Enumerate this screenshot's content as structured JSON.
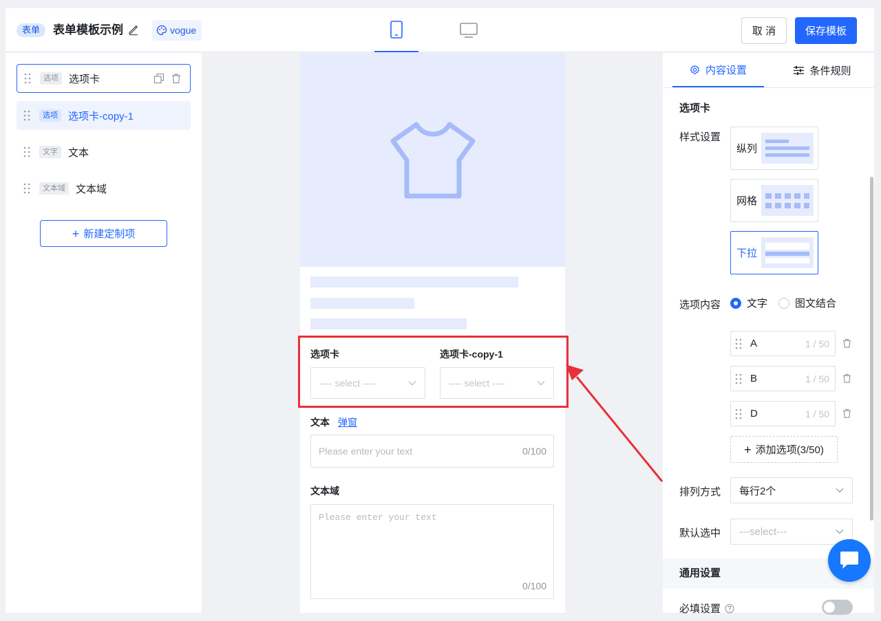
{
  "header": {
    "badge": "表单",
    "title": "表单模板示例",
    "theme": "vogue",
    "cancel": "取 消",
    "save": "保存模板"
  },
  "left": {
    "items": [
      {
        "tag": "选项",
        "label": "选项卡"
      },
      {
        "tag": "选项",
        "label": "选项卡-copy-1"
      },
      {
        "tag": "文字",
        "label": "文本"
      },
      {
        "tag": "文本域",
        "label": "文本域"
      }
    ],
    "new_button": "新建定制项"
  },
  "preview": {
    "field1_title": "选项卡",
    "field2_title": "选项卡-copy-1",
    "select_placeholder": "---- select ----",
    "text_title": "文本",
    "text_link": "弹窗",
    "text_placeholder": "Please enter your text",
    "text_counter": "0/100",
    "textarea_title": "文本域",
    "textarea_placeholder": "Please enter your text",
    "textarea_counter": "0/100"
  },
  "right": {
    "tabs": [
      "内容设置",
      "条件规则"
    ],
    "section_title": "选项卡",
    "style_label": "样式设置",
    "styles": [
      "纵列",
      "网格",
      "下拉"
    ],
    "content_label": "选项内容",
    "content_options": [
      "文字",
      "图文结合"
    ],
    "options": [
      {
        "value": "A",
        "count": "1 / 50"
      },
      {
        "value": "B",
        "count": "1 / 50"
      },
      {
        "value": "D",
        "count": "1 / 50"
      }
    ],
    "add_option": "添加选项(3/50)",
    "arrange_label": "排列方式",
    "arrange_value": "每行2个",
    "default_label": "默认选中",
    "default_placeholder": "---select---",
    "general_section": "通用设置",
    "required_label": "必填设置"
  },
  "colors": {
    "accent": "#2367ff",
    "annotation": "#e8303a",
    "skeleton": "#e6ecfd"
  }
}
